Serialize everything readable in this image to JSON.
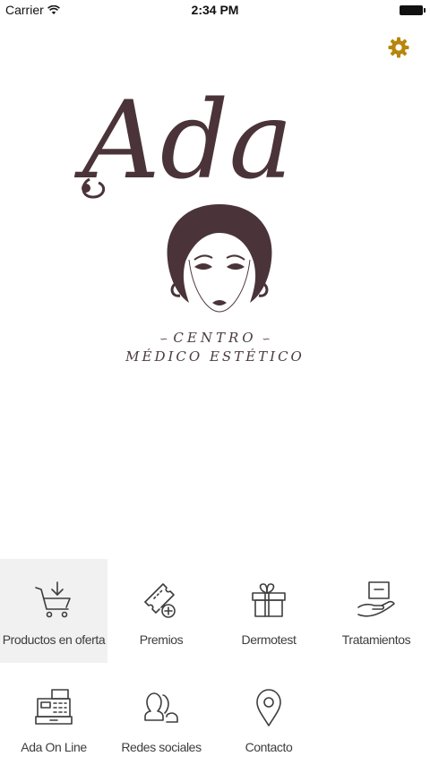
{
  "status_bar": {
    "carrier": "Carrier",
    "time": "2:34 PM"
  },
  "header": {
    "settings_icon": "gear-icon",
    "accent_color": "#b8860b"
  },
  "logo": {
    "wordmark": "Ada",
    "line1": "CENTRO",
    "line2": "MÉDICO ESTÉTICO",
    "color": "#4a3439"
  },
  "menu": {
    "items": [
      {
        "label": "Productos en oferta",
        "icon": "cart-icon"
      },
      {
        "label": "Premios",
        "icon": "ticket-icon"
      },
      {
        "label": "Dermotest",
        "icon": "gift-icon"
      },
      {
        "label": "Tratamientos",
        "icon": "hand-box-icon"
      },
      {
        "label": "Ada On Line",
        "icon": "cash-register-icon"
      },
      {
        "label": "Redes sociales",
        "icon": "people-icon"
      },
      {
        "label": "Contacto",
        "icon": "location-pin-icon"
      }
    ]
  }
}
